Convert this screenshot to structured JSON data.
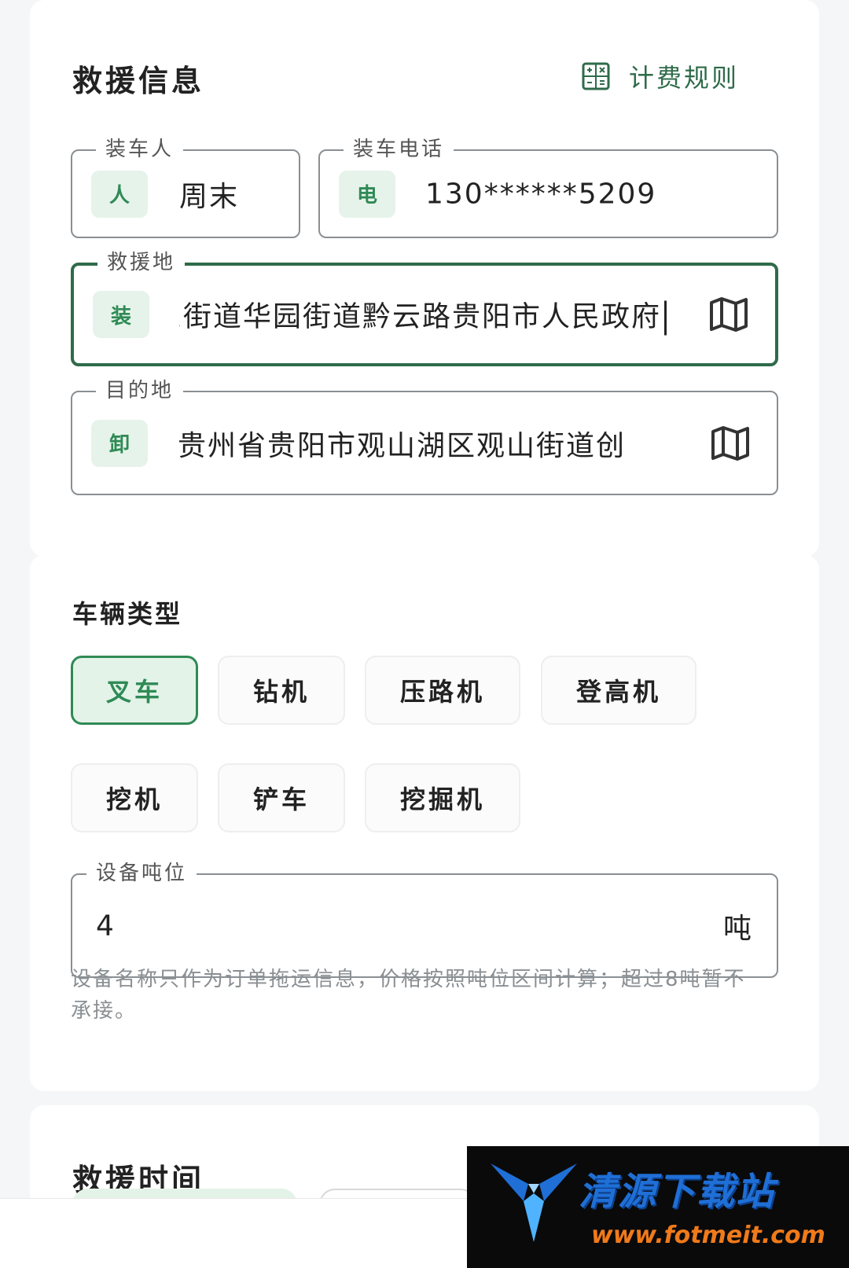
{
  "rescue_info": {
    "title": "救援信息",
    "fee_rule_label": "计费规则",
    "loader_name": {
      "label": "装车人",
      "badge": "人",
      "value": "周末"
    },
    "loader_phone": {
      "label": "装车电话",
      "badge": "电",
      "value": "130******5209"
    },
    "rescue_location": {
      "label": "救援地",
      "badge": "装",
      "value": "云岩区黔东街道华园街道黔云路贵阳市人民政府"
    },
    "destination": {
      "label": "目的地",
      "badge": "卸",
      "value": "贵州省贵阳市观山湖区观山街道创"
    }
  },
  "vehicle_type": {
    "title": "车辆类型",
    "options": [
      "叉车",
      "钻机",
      "压路机",
      "登高机",
      "挖机",
      "铲车",
      "挖掘机"
    ],
    "selected": "叉车"
  },
  "tonnage": {
    "label": "设备吨位",
    "value": "4",
    "unit": "吨",
    "hint": "设备名称只作为订单拖运信息，价格按照吨位区间计算；超过8吨暂不承接。"
  },
  "rescue_time": {
    "title": "救援时间"
  },
  "watermark": {
    "title": "清源下载站",
    "url": "www.fotmeit.com"
  },
  "colors": {
    "accent": "#2f6b4a",
    "badge_bg": "#e6f3ea",
    "selected_chip_bg": "#e3f3e8",
    "selected_chip_border": "#2f8a55"
  }
}
